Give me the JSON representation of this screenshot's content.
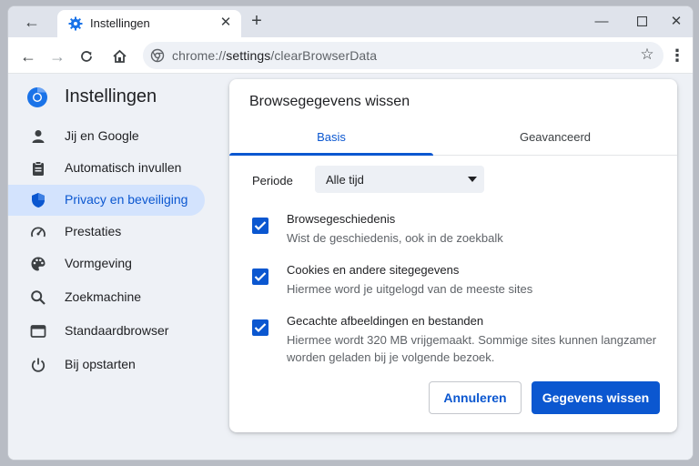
{
  "tab": {
    "title": "Instellingen"
  },
  "address_bar": {
    "scheme": "chrome://",
    "host": "settings",
    "path": "/clearBrowserData"
  },
  "sidebar": {
    "title": "Instellingen",
    "items": [
      {
        "label": "Jij en Google",
        "icon": "person-icon"
      },
      {
        "label": "Automatisch invullen",
        "icon": "clipboard-icon"
      },
      {
        "label": "Privacy en beveiliging",
        "icon": "shield-icon",
        "active": true
      },
      {
        "label": "Prestaties",
        "icon": "speedometer-icon"
      },
      {
        "label": "Vormgeving",
        "icon": "palette-icon"
      },
      {
        "label": "Zoekmachine",
        "icon": "search-icon"
      },
      {
        "label": "Standaardbrowser",
        "icon": "browser-window-icon"
      },
      {
        "label": "Bij opstarten",
        "icon": "power-icon"
      }
    ]
  },
  "dialog": {
    "title": "Browsegegevens wissen",
    "tabs": [
      "Basis",
      "Geavanceerd"
    ],
    "active_tab": 0,
    "period_label": "Periode",
    "period_value": "Alle tijd",
    "options": [
      {
        "title": "Browsegeschiedenis",
        "desc": "Wist de geschiedenis, ook in de zoekbalk",
        "checked": true
      },
      {
        "title": "Cookies en andere sitegegevens",
        "desc": "Hiermee word je uitgelogd van de meeste sites",
        "checked": true
      },
      {
        "title": "Gecachte afbeeldingen en bestanden",
        "desc": "Hiermee wordt 320 MB vrijgemaakt. Sommige sites kunnen langzamer worden geladen bij je volgende bezoek.",
        "checked": true
      }
    ],
    "cancel_label": "Annuleren",
    "confirm_label": "Gegevens wissen"
  },
  "colors": {
    "accent": "#0b57d0",
    "active_nav_bg": "#d3e3fd",
    "page_bg": "#eef1f6"
  }
}
